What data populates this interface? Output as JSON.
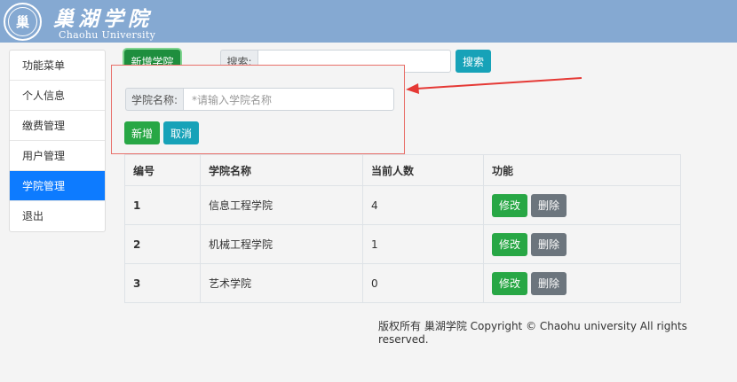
{
  "header": {
    "logo_char": "巢",
    "school_name": "巢湖学院",
    "school_en": "Chaohu University"
  },
  "sidebar": {
    "items": [
      {
        "label": "功能菜单"
      },
      {
        "label": "个人信息"
      },
      {
        "label": "缴费管理"
      },
      {
        "label": "用户管理"
      },
      {
        "label": "学院管理"
      },
      {
        "label": "退出"
      }
    ],
    "active_index": 4
  },
  "toolbar": {
    "add_college_label": "新增学院",
    "search_label": "搜索:",
    "search_value": "",
    "search_button": "搜索"
  },
  "form": {
    "name_label": "学院名称:",
    "name_placeholder": "*请输入学院名称",
    "add_button": "新增",
    "cancel_button": "取消"
  },
  "table": {
    "headers": [
      "编号",
      "学院名称",
      "当前人数",
      "功能"
    ],
    "rows": [
      {
        "id": "1",
        "name": "信息工程学院",
        "count": "4"
      },
      {
        "id": "2",
        "name": "机械工程学院",
        "count": "1"
      },
      {
        "id": "3",
        "name": "艺术学院",
        "count": "0"
      }
    ],
    "edit_label": "修改",
    "delete_label": "删除"
  },
  "footer": {
    "text": "版权所有 巢湖学院 Copyright © Chaohu university All rights reserved."
  },
  "colors": {
    "header_bg": "#85a9d2",
    "active_nav": "#0d7bff",
    "green": "#28a745",
    "teal": "#17a2b8",
    "gray": "#6c757d",
    "annotation_red": "#e53935"
  }
}
